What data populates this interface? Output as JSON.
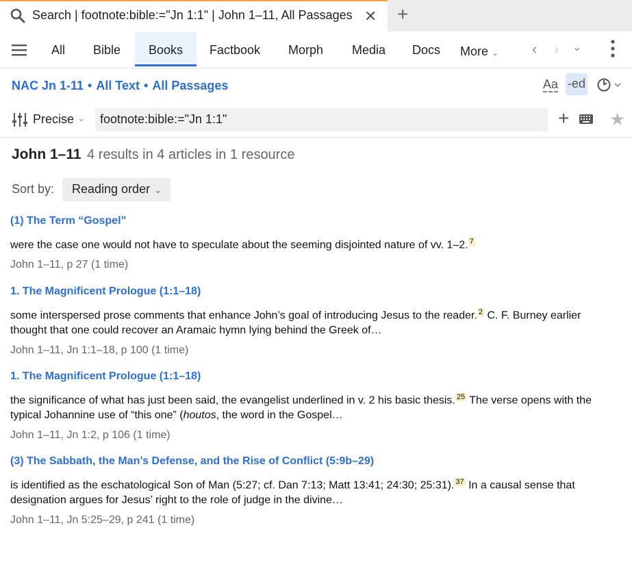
{
  "tab": {
    "title": "Search | footnote:bible:=\"Jn 1:1\" | John 1–11, All Passages"
  },
  "nav": {
    "items": [
      "All",
      "Bible",
      "Books",
      "Factbook",
      "Morph",
      "Media",
      "Docs"
    ],
    "more_label": "More",
    "active": "Books"
  },
  "breadcrumbs": {
    "resource": "NAC Jn 1-11",
    "scope": "All Text",
    "passages": "All Passages"
  },
  "toolbar": {
    "font_label": "Aa",
    "edit_label": "-ed"
  },
  "search": {
    "mode_label": "Precise",
    "query": "footnote:bible:=\"Jn 1:1\""
  },
  "results": {
    "title": "John 1–11",
    "count_text": "4 results in 4 articles in 1 resource",
    "sort_label": "Sort by:",
    "sort_value": "Reading order",
    "items": [
      {
        "heading": "(1) The Term “Gospel”",
        "snippet_before": "were the case one would not have to speculate about the seeming disjointed nature of vv. 1–2.",
        "footnote": "7",
        "snippet_after": "",
        "source": "John 1–11, p 27 (1 time)"
      },
      {
        "heading": "1. The Magnificent Prologue (1:1–18)",
        "snippet_before": "some interspersed prose comments that enhance John’s goal of introducing Jesus to the reader.",
        "footnote": "2",
        "snippet_after": " C. F. Burney earlier thought that one could recover an Aramaic hymn lying behind the Greek of…",
        "source": "John 1–11, Jn 1:1–18, p 100 (1 time)"
      },
      {
        "heading": "1. The Magnificent Prologue (1:1–18)",
        "snippet_before": "the significance of what has just been said, the evangelist underlined in v. 2 his basic thesis.",
        "footnote": "25",
        "snippet_after_a": " The verse opens with the typical Johannine use of “this one” (",
        "snippet_italic": "houtos",
        "snippet_after_b": ", the word in the Gospel…",
        "source": "John 1–11, Jn 1:2, p 106 (1 time)"
      },
      {
        "heading": "(3) The Sabbath, the Man’s Defense, and the Rise of Conflict (5:9b–29)",
        "snippet_before": "is identified as the eschatological Son of Man (5:27; cf. Dan 7:13; Matt 13:41; 24:30; 25:31).",
        "footnote": "37",
        "snippet_after": " In a causal sense that designation argues for Jesus’ right to the role of judge in the divine…",
        "source": "John 1–11, Jn 5:25–29, p 241 (1 time)"
      }
    ]
  },
  "colors": {
    "link": "#2e6fcf",
    "active_tab_accent": "#2e6fcf",
    "tab_top_accent": "#f0a04b",
    "footnote_highlight": "#fdf0c6"
  }
}
